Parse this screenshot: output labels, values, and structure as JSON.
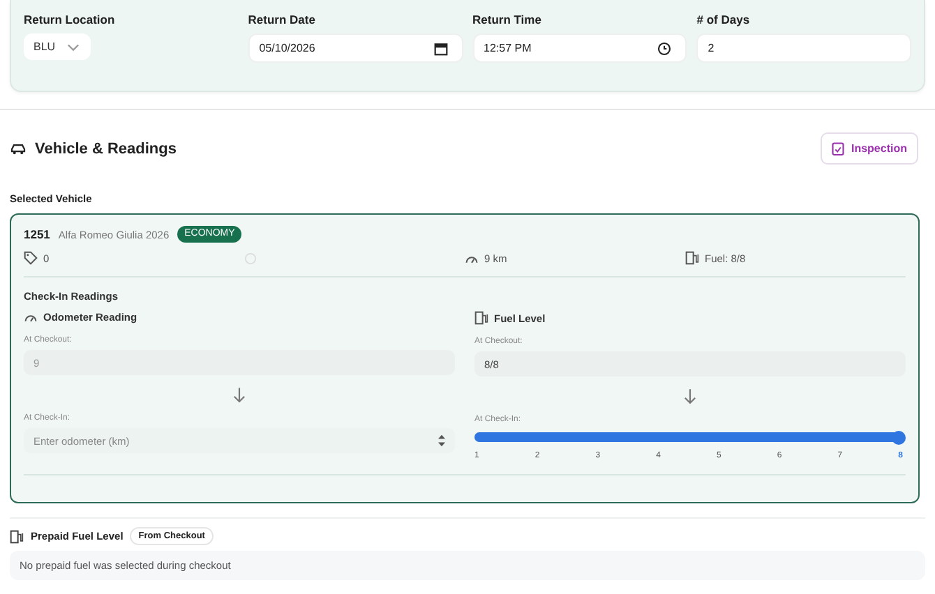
{
  "return_fields": [
    {
      "label": "Return Location",
      "kind": "select",
      "value": "BLU"
    },
    {
      "label": "Return Date",
      "kind": "date",
      "value": "05/10/2026"
    },
    {
      "label": "Return Time",
      "kind": "time",
      "value": "12:57 PM"
    },
    {
      "label": "# of Days",
      "kind": "text",
      "value": "2"
    }
  ],
  "section": {
    "title": "Vehicle & Readings",
    "button": "Inspection"
  },
  "selected_vehicle": {
    "label": "Selected Vehicle",
    "number": "1251",
    "model": "Alfa Romeo Giulia 2026",
    "badge": "ECONOMY",
    "tag_count": "0",
    "mileage": "9 km",
    "fuel": "Fuel: 8/8"
  },
  "readings": {
    "title": "Check-In Readings",
    "odometer": {
      "title": "Odometer Reading",
      "checkout_label": "At Checkout:",
      "checkout_value": "9",
      "checkin_label": "At Check-In:",
      "placeholder": "Enter odometer (km)"
    },
    "fuel": {
      "title": "Fuel Level",
      "checkout_label": "At Checkout:",
      "checkout_value": "8/8",
      "checkin_label": "At Check-In:",
      "level": 1,
      "ticks": [
        {
          "label": "1",
          "selected": false
        },
        {
          "label": "2",
          "selected": false
        },
        {
          "label": "3",
          "selected": false
        },
        {
          "label": "4",
          "selected": false
        },
        {
          "label": "5",
          "selected": false
        },
        {
          "label": "6",
          "selected": false
        },
        {
          "label": "7",
          "selected": false
        },
        {
          "label": "8",
          "selected": true
        }
      ]
    }
  },
  "prepaid": {
    "title": "Prepaid Fuel Level",
    "badge": "From Checkout",
    "message": "No prepaid fuel was selected during checkout"
  }
}
